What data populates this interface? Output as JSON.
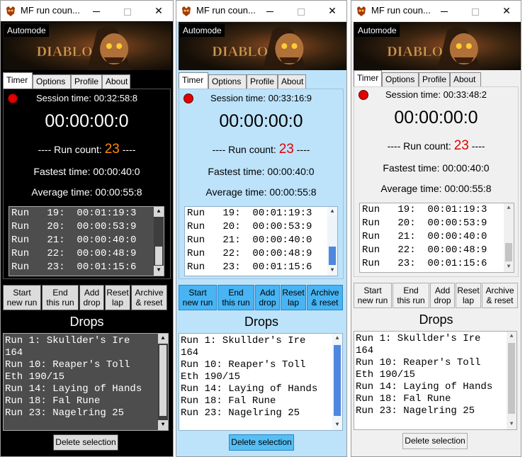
{
  "windows": [
    {
      "theme": "dark",
      "title": "MF run coun...",
      "controls": {
        "minimize": "minimize",
        "maximize": "maximize",
        "close": "✕"
      },
      "automode_label": "Automode",
      "tabs": [
        "Timer",
        "Options",
        "Profile",
        "About"
      ],
      "active_tab": "Timer",
      "session_label": "Session time: ",
      "session_time": "00:32:58:8",
      "run_timer": "00:00:00:0",
      "run_count_prefix": "---- Run count: ",
      "run_count": "23",
      "run_count_suffix": " ----",
      "fastest_label": "Fastest time: ",
      "fastest_time": "00:00:40:0",
      "average_label": "Average time: ",
      "average_time": "00:00:55:8",
      "run_list": [
        "Run   19:  00:01:19:3",
        "Run   20:  00:00:53:9",
        "Run   21:  00:00:40:0",
        "Run   22:  00:00:48:9",
        "Run   23:  00:01:15:6"
      ],
      "buttons": [
        {
          "line1": "Start",
          "line2": "new run"
        },
        {
          "line1": "End",
          "line2": "this run"
        },
        {
          "line1": "Add",
          "line2": "drop"
        },
        {
          "line1": "Reset",
          "line2": "lap"
        },
        {
          "line1": "Archive",
          "line2": "& reset"
        }
      ],
      "drops_title": "Drops",
      "drops": [
        "Run 1: Skullder's Ire",
        "164",
        "Run 10: Reaper's Toll",
        "Eth 190/15",
        "Run 14: Laying of Hands",
        "Run 18: Fal Rune",
        "Run 23: Nagelring 25"
      ],
      "delete_label": "Delete selection",
      "colors": {
        "count": "#ff8c00",
        "accent": "#000000"
      }
    },
    {
      "theme": "blue",
      "title": "MF run coun...",
      "controls": {
        "minimize": "minimize",
        "maximize": "maximize",
        "close": "✕"
      },
      "automode_label": "Automode",
      "tabs": [
        "Timer",
        "Options",
        "Profile",
        "About"
      ],
      "active_tab": "Timer",
      "session_label": "Session time: ",
      "session_time": "00:33:16:9",
      "run_timer": "00:00:00:0",
      "run_count_prefix": "---- Run count: ",
      "run_count": "23",
      "run_count_suffix": " ----",
      "fastest_label": "Fastest time: ",
      "fastest_time": "00:00:40:0",
      "average_label": "Average time: ",
      "average_time": "00:00:55:8",
      "run_list": [
        "Run   19:  00:01:19:3",
        "Run   20:  00:00:53:9",
        "Run   21:  00:00:40:0",
        "Run   22:  00:00:48:9",
        "Run   23:  00:01:15:6"
      ],
      "buttons": [
        {
          "line1": "Start",
          "line2": "new run"
        },
        {
          "line1": "End",
          "line2": "this run"
        },
        {
          "line1": "Add",
          "line2": "drop"
        },
        {
          "line1": "Reset",
          "line2": "lap"
        },
        {
          "line1": "Archive",
          "line2": "& reset"
        }
      ],
      "drops_title": "Drops",
      "drops": [
        "Run 1: Skullder's Ire",
        "164",
        "Run 10: Reaper's Toll",
        "Eth 190/15",
        "Run 14: Laying of Hands",
        "Run 18: Fal Rune",
        "Run 23: Nagelring 25"
      ],
      "delete_label": "Delete selection",
      "colors": {
        "count": "#e00000",
        "accent": "#48b4f3"
      }
    },
    {
      "theme": "light",
      "title": "MF run coun...",
      "controls": {
        "minimize": "minimize",
        "maximize": "maximize",
        "close": "✕"
      },
      "automode_label": "Automode",
      "tabs": [
        "Timer",
        "Options",
        "Profile",
        "About"
      ],
      "active_tab": "Timer",
      "session_label": "Session time: ",
      "session_time": "00:33:48:2",
      "run_timer": "00:00:00:0",
      "run_count_prefix": "---- Run count: ",
      "run_count": "23",
      "run_count_suffix": " ----",
      "fastest_label": "Fastest time: ",
      "fastest_time": "00:00:40:0",
      "average_label": "Average time: ",
      "average_time": "00:00:55:8",
      "run_list": [
        "Run   19:  00:01:19:3",
        "Run   20:  00:00:53:9",
        "Run   21:  00:00:40:0",
        "Run   22:  00:00:48:9",
        "Run   23:  00:01:15:6"
      ],
      "buttons": [
        {
          "line1": "Start",
          "line2": "new run"
        },
        {
          "line1": "End",
          "line2": "this run"
        },
        {
          "line1": "Add",
          "line2": "drop"
        },
        {
          "line1": "Reset",
          "line2": "lap"
        },
        {
          "line1": "Archive",
          "line2": "& reset"
        }
      ],
      "drops_title": "Drops",
      "drops": [
        "Run 1: Skullder's Ire",
        "164",
        "Run 10: Reaper's Toll",
        "Eth 190/15",
        "Run 14: Laying of Hands",
        "Run 18: Fal Rune",
        "Run 23: Nagelring 25"
      ],
      "delete_label": "Delete selection",
      "colors": {
        "count": "#e00000",
        "accent": "#f0f0f0"
      }
    }
  ]
}
